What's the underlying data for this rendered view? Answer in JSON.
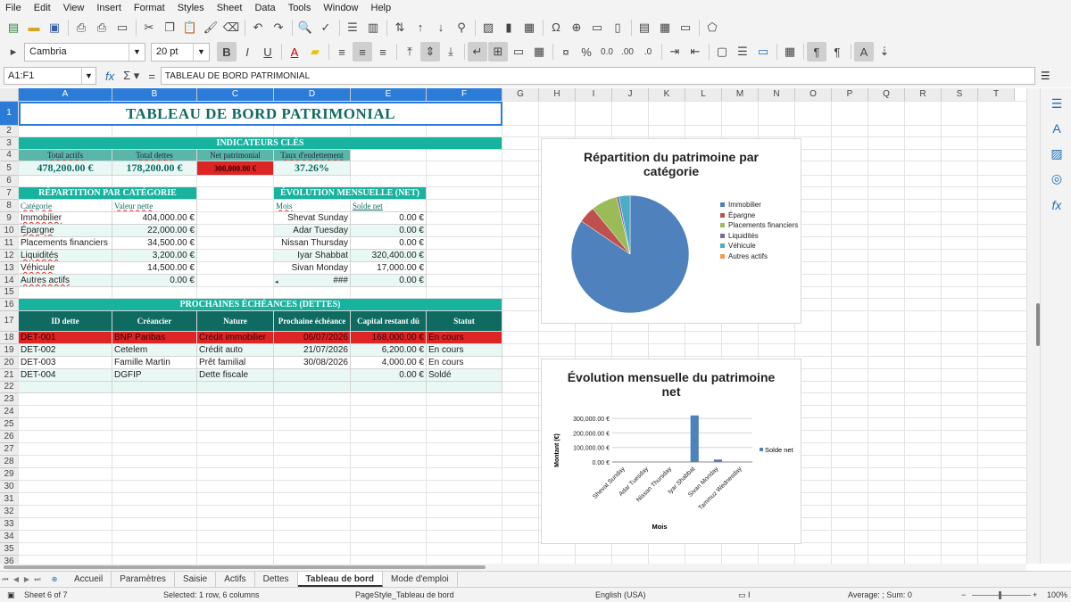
{
  "menu": [
    "File",
    "Edit",
    "View",
    "Insert",
    "Format",
    "Styles",
    "Sheet",
    "Data",
    "Tools",
    "Window",
    "Help"
  ],
  "font": {
    "name": "Cambria",
    "size": "20 pt"
  },
  "formula": {
    "cell_ref": "A1:F1",
    "content": "TABLEAU DE BORD PATRIMONIAL"
  },
  "columns": [
    "A",
    "B",
    "C",
    "D",
    "E",
    "F",
    "G",
    "H",
    "I",
    "J",
    "K",
    "L",
    "M",
    "N",
    "O",
    "P",
    "Q",
    "R",
    "S",
    "T"
  ],
  "rows": [
    "1",
    "2",
    "3",
    "4",
    "5",
    "6",
    "7",
    "8",
    "9",
    "10",
    "11",
    "12",
    "13",
    "14",
    "15",
    "16",
    "17",
    "18",
    "19",
    "20",
    "21",
    "22",
    "23",
    "24",
    "25",
    "26",
    "27",
    "28",
    "29",
    "30",
    "31",
    "32",
    "33",
    "34",
    "35",
    "36"
  ],
  "title": "TABLEAU DE BORD PATRIMONIAL",
  "kpi": {
    "header": "INDICATEURS CLÉS",
    "labels": [
      "Total actifs",
      "Total dettes",
      "Net patrimonial",
      "Taux d'endettement"
    ],
    "values": [
      "478,200.00 €",
      "178,200.00 €",
      "300,000.00 €",
      "37.26%"
    ]
  },
  "repartition": {
    "header": "RÉPARTITION PAR CATÉGORIE",
    "col1": "Catégorie",
    "col2": "Valeur nette",
    "rows": [
      {
        "cat": "Immobilier",
        "val": "404,000.00 €"
      },
      {
        "cat": "Épargne",
        "val": "22,000.00 €"
      },
      {
        "cat": "Placements financiers",
        "val": "34,500.00 €"
      },
      {
        "cat": "Liquidités",
        "val": "3,200.00 €"
      },
      {
        "cat": "Véhicule",
        "val": "14,500.00 €"
      },
      {
        "cat": "Autres actifs",
        "val": "0.00 €"
      }
    ]
  },
  "evolution": {
    "header": "ÉVOLUTION MENSUELLE (NET)",
    "col1": "Mois",
    "col2": "Solde net",
    "rows": [
      {
        "mois": "Shevat Sunday",
        "val": "0.00 €"
      },
      {
        "mois": "Adar Tuesday",
        "val": "0.00 €"
      },
      {
        "mois": "Nissan Thursday",
        "val": "0.00 €"
      },
      {
        "mois": "Iyar Shabbat",
        "val": "320,400.00 €"
      },
      {
        "mois": "Sivan Monday",
        "val": "17,000.00 €"
      },
      {
        "mois": "###",
        "val": "0.00 €"
      }
    ]
  },
  "echeances": {
    "header": "PROCHAINES ÉCHÉANCES (DETTES)",
    "cols": [
      "ID dette",
      "Créancier",
      "Nature",
      "Prochaine échéance",
      "Capital restant dû",
      "Statut"
    ],
    "rows": [
      [
        "DET-001",
        "BNP Paribas",
        "Crédit immobilier",
        "06/07/2026",
        "168,000.00 €",
        "En cours"
      ],
      [
        "DET-002",
        "Cetelem",
        "Crédit auto",
        "21/07/2026",
        "6,200.00 €",
        "En cours"
      ],
      [
        "DET-003",
        "Famille Martin",
        "Prêt familial",
        "30/08/2026",
        "4,000.00 €",
        "En cours"
      ],
      [
        "DET-004",
        "DGFIP",
        "Dette fiscale",
        "",
        "0.00 €",
        "Soldé"
      ]
    ]
  },
  "pie_chart": {
    "title": "Répartition du patrimoine par catégorie",
    "legend": [
      "Immobilier",
      "Épargne",
      "Placements financiers",
      "Liquidités",
      "Véhicule",
      "Autres actifs"
    ],
    "colors": [
      "#4f81bd",
      "#c0504d",
      "#9bbb59",
      "#8064a2",
      "#4bacc6",
      "#f79646"
    ],
    "values": [
      404000,
      22000,
      34500,
      3200,
      14500,
      0
    ]
  },
  "bar_chart": {
    "title": "Évolution mensuelle du patrimoine net",
    "ylabel": "Montant (€)",
    "xlabel": "Mois",
    "legend": "Solde net",
    "yticks": [
      "300,000.00 €",
      "200,000.00 €",
      "100,000.00 €",
      "0.00 €"
    ],
    "categories": [
      "Shevat Sunday",
      "Adar Tuesday",
      "Nissan Thursday",
      "Iyar Shabbat",
      "Sivan Monday",
      "Tammuz Wednesday"
    ],
    "values": [
      0,
      0,
      0,
      320400,
      17000,
      0
    ],
    "ymax": 350000
  },
  "tabs": [
    "Accueil",
    "Paramètres",
    "Saisie",
    "Actifs",
    "Dettes",
    "Tableau de bord",
    "Mode d'emploi"
  ],
  "status": {
    "sheet": "Sheet 6 of 7",
    "selected": "Selected: 1 row, 6 columns",
    "pagestyle": "PageStyle_Tableau de bord",
    "lang": "English (USA)",
    "summary": "Average: ; Sum: 0",
    "zoom": "100%"
  }
}
